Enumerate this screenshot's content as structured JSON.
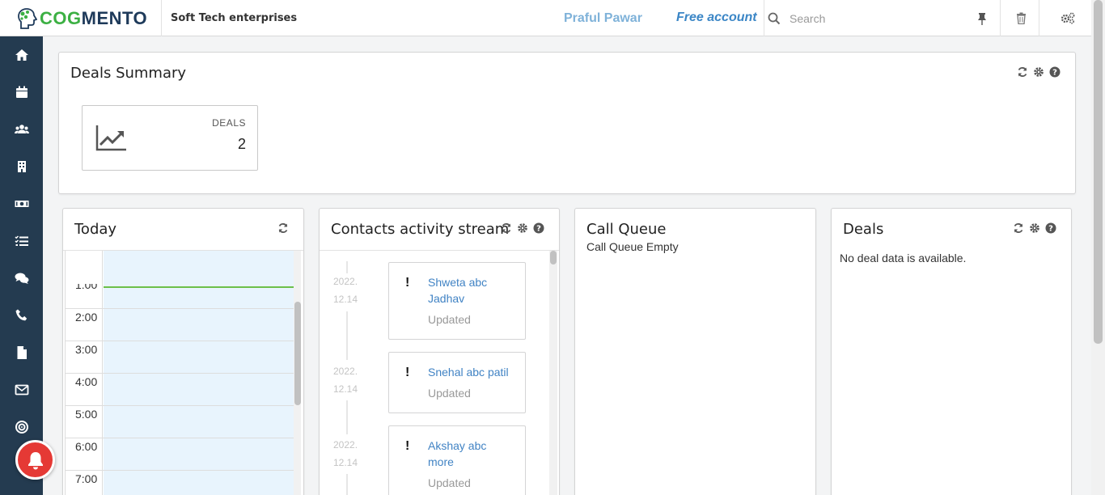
{
  "header": {
    "logo_cog": "COG",
    "logo_mento": "MENTO",
    "company": "Soft Tech enterprises",
    "user_name": "Praful Pawar",
    "account": "Free account",
    "search_placeholder": "Search"
  },
  "sidebar": {
    "items": [
      {
        "icon": "home-icon"
      },
      {
        "icon": "calendar-icon"
      },
      {
        "icon": "contacts-icon"
      },
      {
        "icon": "companies-icon"
      },
      {
        "icon": "deals-money-icon"
      },
      {
        "icon": "tasks-icon"
      },
      {
        "icon": "cases-chat-icon"
      },
      {
        "icon": "calls-phone-icon"
      },
      {
        "icon": "documents-icon"
      },
      {
        "icon": "email-icon"
      },
      {
        "icon": "campaigns-target-icon"
      }
    ]
  },
  "deals_summary": {
    "title": "Deals Summary",
    "tile_label": "DEALS",
    "tile_value": "2"
  },
  "today": {
    "title": "Today",
    "partial_time": "1:00",
    "times": [
      "2:00",
      "3:00",
      "4:00",
      "5:00",
      "6:00",
      "7:00"
    ]
  },
  "activity": {
    "title": "Contacts activity stream",
    "items": [
      {
        "date_year": "2022.",
        "date_md": "12.14",
        "name": "Shweta abc Jadhav",
        "status": "Updated"
      },
      {
        "date_year": "2022.",
        "date_md": "12.14",
        "name": "Snehal abc patil",
        "status": "Updated"
      },
      {
        "date_year": "2022.",
        "date_md": "12.14",
        "name": "Akshay abc more",
        "status": "Updated"
      }
    ]
  },
  "call_queue": {
    "title": "Call Queue",
    "empty_text": "Call Queue Empty"
  },
  "deals": {
    "title": "Deals",
    "empty_text": "No deal data is available."
  },
  "colors": {
    "sidebar_bg": "#243b50",
    "accent_green": "#3cb043",
    "link_blue": "#4183c4",
    "notification_red": "#e53935"
  }
}
